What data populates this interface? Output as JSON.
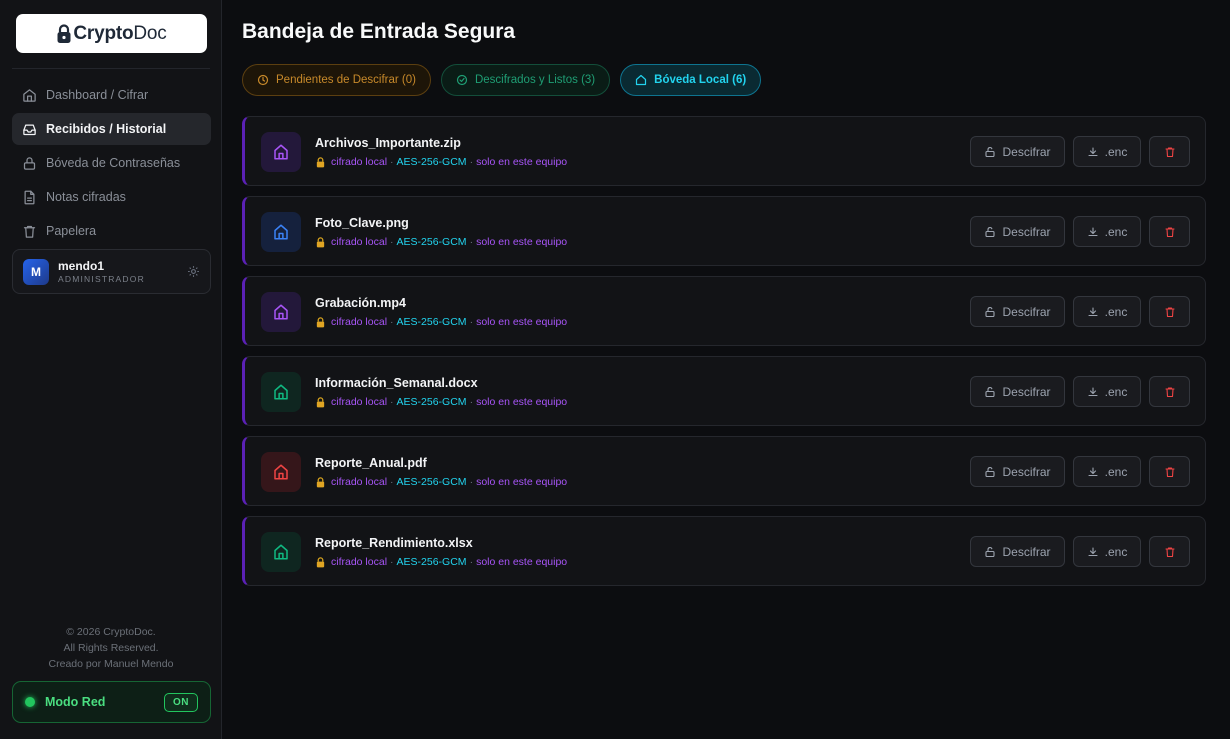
{
  "app": {
    "logo_prefix": "Crypto",
    "logo_suffix": "Doc"
  },
  "sidebar": {
    "items": [
      {
        "label": "Dashboard / Cifrar",
        "icon": "home-icon"
      },
      {
        "label": "Recibidos / Historial",
        "icon": "inbox-icon",
        "active": true
      },
      {
        "label": "Bóveda de Contraseñas",
        "icon": "lock-icon"
      },
      {
        "label": "Notas cifradas",
        "icon": "note-icon"
      },
      {
        "label": "Papelera",
        "icon": "trash-icon"
      }
    ],
    "user": {
      "initial": "M",
      "name": "mendo1",
      "role": "ADMINISTRADOR"
    },
    "copyright": {
      "line1": "© 2026 CryptoDoc.",
      "line2": "All Rights Reserved.",
      "line3": "Creado por Manuel Mendo"
    },
    "network": {
      "label": "Modo Red",
      "toggle": "ON"
    }
  },
  "main": {
    "title": "Bandeja de Entrada Segura",
    "tabs": [
      {
        "label": "Pendientes de Descifrar (0)"
      },
      {
        "label": "Descifrados y Listos (3)"
      },
      {
        "label": "Bóveda Local (6)",
        "active": true
      }
    ],
    "actions": {
      "decrypt": "Descifrar",
      "download": ".enc"
    },
    "files": [
      {
        "name": "Archivos_Importante.zip",
        "tag": "cifrado local",
        "algo": "AES-256-GCM",
        "scope": "solo en este equipo",
        "icon_color": "#a855f7",
        "icon_bg": "#23183a"
      },
      {
        "name": "Foto_Clave.png",
        "tag": "cifrado local",
        "algo": "AES-256-GCM",
        "scope": "solo en este equipo",
        "icon_color": "#3b82f6",
        "icon_bg": "#15213d"
      },
      {
        "name": "Grabación.mp4",
        "tag": "cifrado local",
        "algo": "AES-256-GCM",
        "scope": "solo en este equipo",
        "icon_color": "#a855f7",
        "icon_bg": "#23183a"
      },
      {
        "name": "Información_Semanal.docx",
        "tag": "cifrado local",
        "algo": "AES-256-GCM",
        "scope": "solo en este equipo",
        "icon_color": "#10b981",
        "icon_bg": "#0f2620"
      },
      {
        "name": "Reporte_Anual.pdf",
        "tag": "cifrado local",
        "algo": "AES-256-GCM",
        "scope": "solo en este equipo",
        "icon_color": "#ef4444",
        "icon_bg": "#35161a"
      },
      {
        "name": "Reporte_Rendimiento.xlsx",
        "tag": "cifrado local",
        "algo": "AES-256-GCM",
        "scope": "solo en este equipo",
        "icon_color": "#10b981",
        "icon_bg": "#0f2620"
      }
    ]
  },
  "colors": {
    "accent_purple": "#a855f7",
    "accent_cyan": "#22d3ee",
    "network_green": "#22c55e",
    "delete_red": "#ef4444"
  }
}
